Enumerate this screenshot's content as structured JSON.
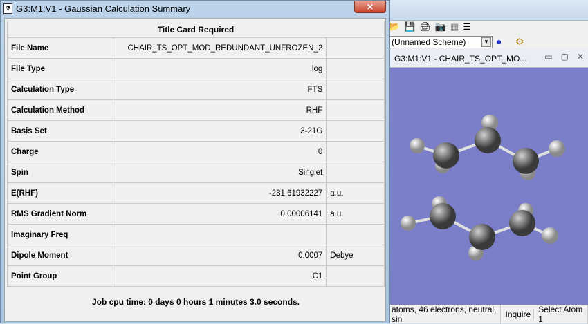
{
  "dialog": {
    "title": "G3:M1:V1 - Gaussian Calculation Summary",
    "close": "✕",
    "header": "Title Card Required",
    "rows": [
      {
        "label": "File Name",
        "value": "CHAIR_TS_OPT_MOD_REDUNDANT_UNFROZEN_2",
        "unit": ""
      },
      {
        "label": "File Type",
        "value": ".log",
        "unit": ""
      },
      {
        "label": "Calculation Type",
        "value": "FTS",
        "unit": ""
      },
      {
        "label": "Calculation Method",
        "value": "RHF",
        "unit": ""
      },
      {
        "label": "Basis Set",
        "value": "3-21G",
        "unit": ""
      },
      {
        "label": "Charge",
        "value": "0",
        "unit": ""
      },
      {
        "label": "Spin",
        "value": "Singlet",
        "unit": ""
      },
      {
        "label": "E(RHF)",
        "value": "-231.61932227",
        "unit": "a.u."
      },
      {
        "label": "RMS Gradient Norm",
        "value": "0.00006141",
        "unit": "a.u."
      },
      {
        "label": "Imaginary Freq",
        "value": "",
        "unit": ""
      },
      {
        "label": "Dipole Moment",
        "value": "0.0007",
        "unit": "Debye"
      },
      {
        "label": "Point Group",
        "value": "C1",
        "unit": ""
      }
    ],
    "footer": "Job cpu time:  0 days  0 hours  1 minutes  3.0 seconds."
  },
  "main": {
    "scheme": "(Unnamed Scheme)",
    "child_title": "G3:M1:V1 - CHAIR_TS_OPT_MO...",
    "viewer_bg": "#7b7fc9",
    "status": [
      "atoms, 46 electrons, neutral, sin",
      "Inquire",
      "Select Atom 1"
    ]
  }
}
